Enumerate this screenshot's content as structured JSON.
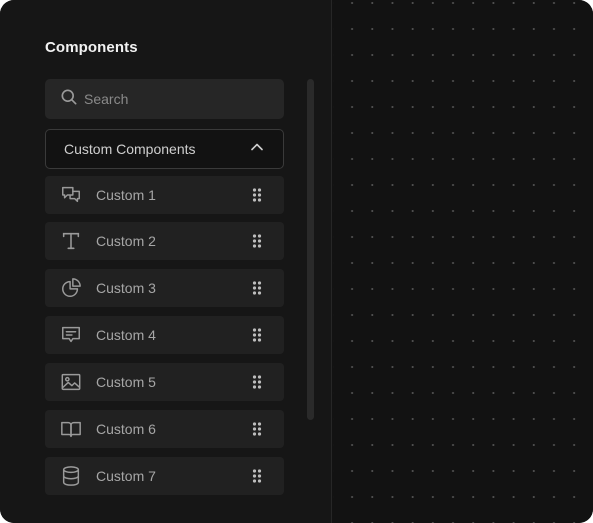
{
  "panel": {
    "title": "Components"
  },
  "search": {
    "placeholder": "Search",
    "value": ""
  },
  "group": {
    "label": "Custom Components",
    "expanded": true
  },
  "items": [
    {
      "label": "Custom 1",
      "icon": "chat-bubbles-icon"
    },
    {
      "label": "Custom 2",
      "icon": "text-type-icon"
    },
    {
      "label": "Custom 3",
      "icon": "pie-chart-icon"
    },
    {
      "label": "Custom 4",
      "icon": "message-square-icon"
    },
    {
      "label": "Custom 5",
      "icon": "image-icon"
    },
    {
      "label": "Custom 6",
      "icon": "book-open-icon"
    },
    {
      "label": "Custom 7",
      "icon": "database-icon"
    }
  ],
  "colors": {
    "canvas_bg": "#121212",
    "panel_bg": "#161616",
    "item_bg": "#212121",
    "text_primary": "#f2f2f2",
    "text_muted": "#a6a6a6",
    "grid_dot": "#4e4e4e"
  }
}
